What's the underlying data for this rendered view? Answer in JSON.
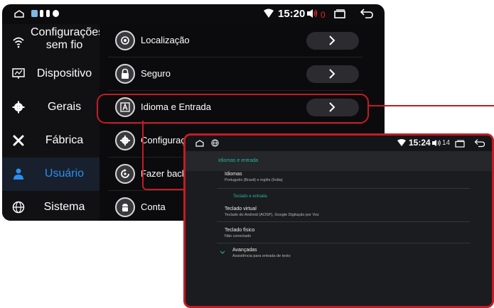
{
  "status_bar": {
    "time": "15:20",
    "volume": "0"
  },
  "sidebar": {
    "items": [
      {
        "label": "Configurações sem fio",
        "line1": "Configurações",
        "line2": "sem fio",
        "icon": "wifi-icon"
      },
      {
        "label": "Dispositivo",
        "icon": "monitor-icon"
      },
      {
        "label": "Gerais",
        "icon": "gear-icon"
      },
      {
        "label": "Fábrica",
        "icon": "tools-icon"
      },
      {
        "label": "Usuário",
        "icon": "user-icon",
        "active": true
      },
      {
        "label": "Sistema",
        "icon": "globe-icon"
      }
    ]
  },
  "settings_list": {
    "items": [
      {
        "label": "Localização",
        "icon": "location-icon"
      },
      {
        "label": "Seguro",
        "icon": "lock-icon"
      },
      {
        "label": "Idioma e Entrada",
        "icon": "keyboard-a-icon",
        "highlighted": true
      },
      {
        "label": "Configuraç",
        "icon": "gear-icon"
      },
      {
        "label": "Fazer back",
        "icon": "backup-icon"
      },
      {
        "label": "Conta",
        "icon": "android-icon"
      }
    ]
  },
  "detail_screen": {
    "status_bar": {
      "time": "15:24",
      "volume": "14"
    },
    "header": "Idiomas e entrada",
    "rows": [
      {
        "title": "Idiomas",
        "subtitle": "Português (Brasil) e inglês (Índia)"
      },
      {
        "category": "Teclado e entrada"
      },
      {
        "title": "Teclado virtual",
        "subtitle": "Teclado do Android (AOSP), Google Digitação por Voz"
      },
      {
        "title": "Teclado físico",
        "subtitle": "Não conectado"
      },
      {
        "title": "Avançadas",
        "subtitle": "Assistência para entrada de texto"
      }
    ]
  },
  "colors": {
    "accent_blue": "#2b8ff0",
    "highlight_red": "#c21c24",
    "teal": "#26b5a0",
    "volume_red": "#e0282a"
  }
}
